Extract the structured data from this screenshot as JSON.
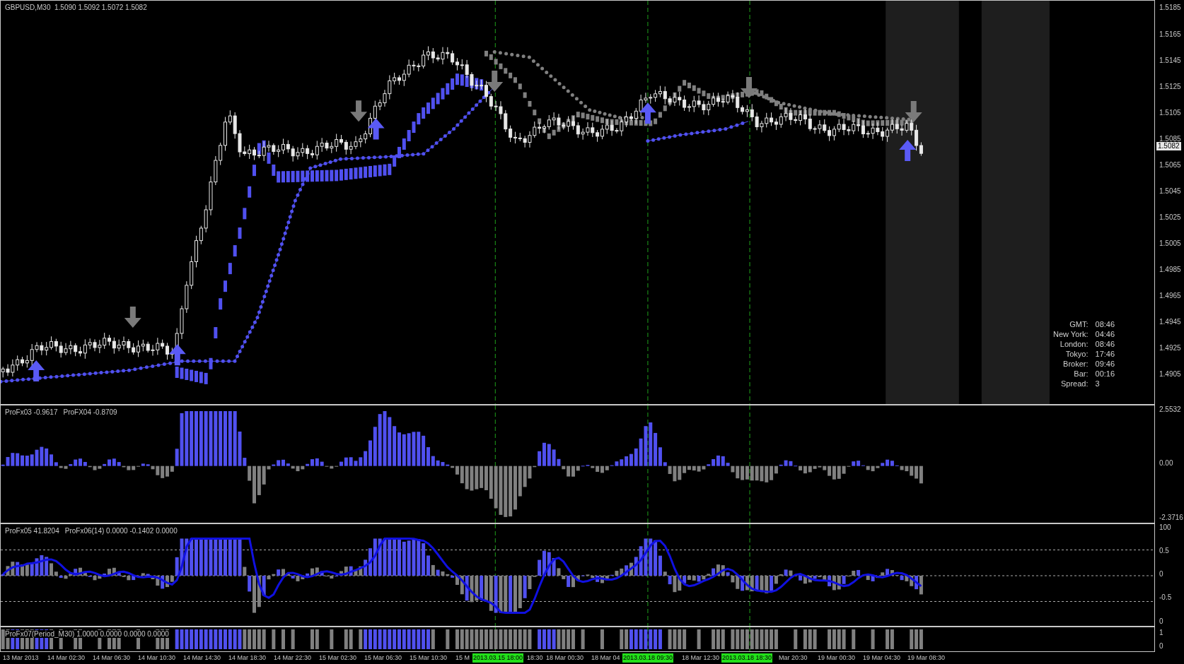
{
  "price_chart": {
    "symbol_info": "GBPUSD,M30  1.5090 1.5092 1.5072 1.5082",
    "price_scale": [
      "1.5185",
      "1.5165",
      "1.5145",
      "1.5125",
      "1.5105",
      "1.5085",
      "1.5065",
      "1.5045",
      "1.5025",
      "1.5005",
      "1.4985",
      "1.4965",
      "1.4945",
      "1.4925",
      "1.4905"
    ],
    "current_price": "1.5082",
    "session_clock": [
      {
        "label": "GMT:",
        "value": "08:46"
      },
      {
        "label": "New York:",
        "value": "04:46"
      },
      {
        "label": "London:",
        "value": "08:46"
      },
      {
        "label": "Tokyo:",
        "value": "17:46"
      },
      {
        "label": "Broker:",
        "value": "09:46"
      },
      {
        "label": "Bar:",
        "value": "00:16"
      },
      {
        "label": "Spread:",
        "value": "3"
      }
    ]
  },
  "indicator_panes": [
    {
      "kind": "histogram",
      "legends": [
        "ProFx03 -0.9617",
        "ProFX04 -0.8709"
      ],
      "scale": [
        "2.5532",
        "0.00",
        "-2.3716"
      ]
    },
    {
      "kind": "oscillator",
      "legends": [
        "ProFx05 41.8204",
        "ProFx06(14) 0.0000 -0.1402 0.0000"
      ],
      "scale": [
        "100",
        "0.5",
        "0",
        "-0.5",
        "0"
      ]
    },
    {
      "kind": "signal",
      "legends": [
        "ProFx07(Period_M30) 1.0000 0.0000 0.0000 0.0000"
      ],
      "scale": [
        "1",
        "0"
      ]
    }
  ],
  "time_axis": [
    {
      "kind": "date",
      "text": "13 Mar 2013"
    },
    {
      "kind": "date",
      "text": "14 Mar 02:30"
    },
    {
      "kind": "date",
      "text": "14 Mar 06:30"
    },
    {
      "kind": "date",
      "text": "14 Mar 10:30"
    },
    {
      "kind": "date",
      "text": "14 Mar 14:30"
    },
    {
      "kind": "date",
      "text": "14 Mar 18:30"
    },
    {
      "kind": "date",
      "text": "14 Mar 22:30"
    },
    {
      "kind": "date",
      "text": "15 Mar 02:30"
    },
    {
      "kind": "date",
      "text": "15 Mar 06:30"
    },
    {
      "kind": "date",
      "text": "15 Mar 10:30"
    },
    {
      "kind": "date",
      "text": "15 M"
    },
    {
      "kind": "marker",
      "text": "2013.03.15 18:00"
    },
    {
      "kind": "date",
      "text": "18:30"
    },
    {
      "kind": "date",
      "text": "18 Mar 00:30"
    },
    {
      "kind": "date",
      "text": "18 Mar 04"
    },
    {
      "kind": "marker",
      "text": "2013.03.18 09:30"
    },
    {
      "kind": "date",
      "text": "18 Mar 12:30"
    },
    {
      "kind": "marker",
      "text": "2013.03.18 18:30"
    },
    {
      "kind": "date",
      "text": "Mar 20:30"
    },
    {
      "kind": "date",
      "text": "19 Mar 00:30"
    },
    {
      "kind": "date",
      "text": "19 Mar 04:30"
    },
    {
      "kind": "date",
      "text": "19 Mar 08:30"
    }
  ]
}
